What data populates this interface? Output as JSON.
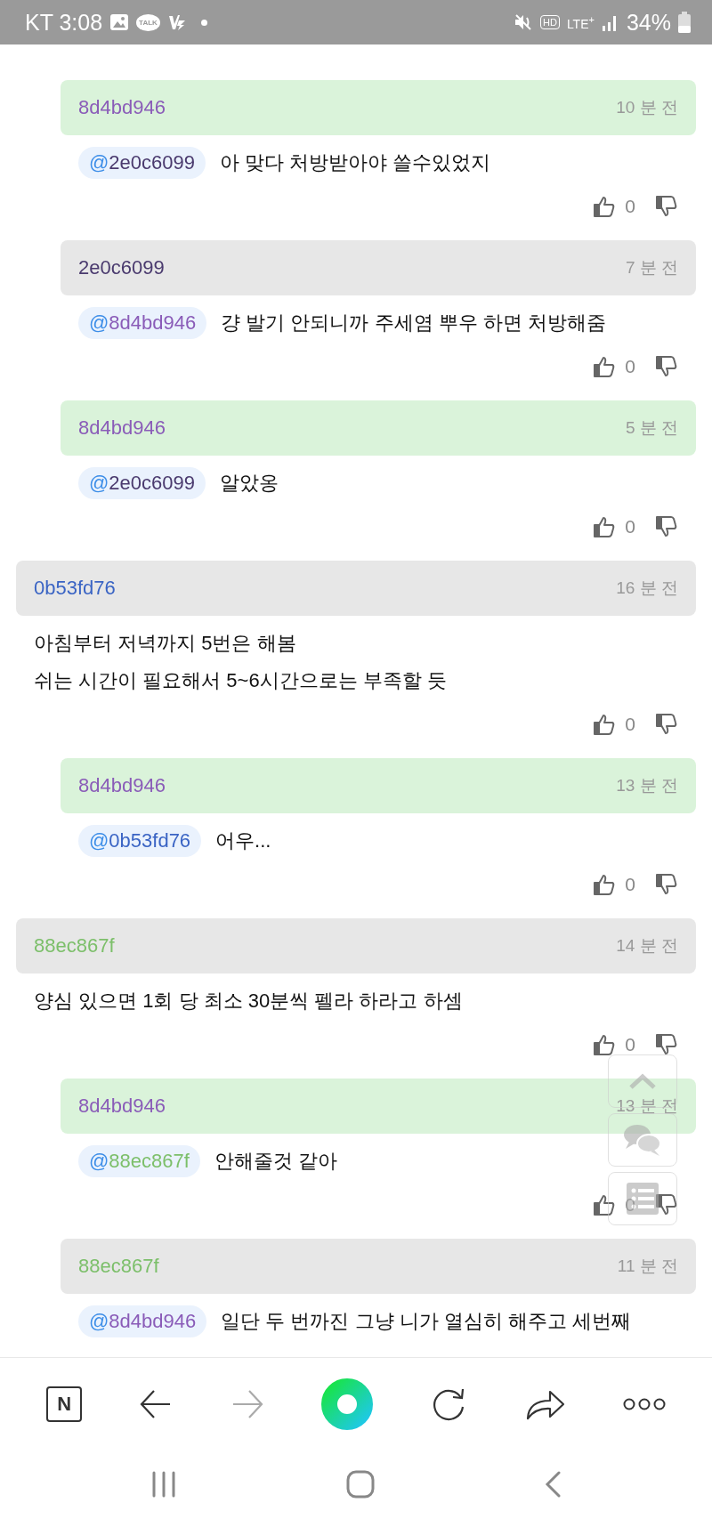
{
  "status_bar": {
    "carrier": "KT",
    "time": "3:08",
    "talk_badge": "TALK",
    "hd_badge": "HD",
    "network": "LTE",
    "network_plus": "+",
    "battery": "34%"
  },
  "comments": [
    {
      "kind": "reply",
      "author": "8d4bd946",
      "color": "#8a5cb8",
      "time": "10 분 전",
      "highlighted": true,
      "mention": {
        "author": "2e0c6099",
        "color": "#4a3a6e"
      },
      "lines": [
        "아 맞다 처방받아야 쓸수있었지"
      ],
      "likes": "0"
    },
    {
      "kind": "reply",
      "author": "2e0c6099",
      "color": "#4a3a6e",
      "time": "7 분 전",
      "highlighted": false,
      "mention": {
        "author": "8d4bd946",
        "color": "#8a5cb8"
      },
      "lines": [
        "걍 발기 안되니까 주세염 뿌우 하면 처방해줌"
      ],
      "likes": "0"
    },
    {
      "kind": "reply",
      "author": "8d4bd946",
      "color": "#8a5cb8",
      "time": "5 분 전",
      "highlighted": true,
      "mention": {
        "author": "2e0c6099",
        "color": "#4a3a6e"
      },
      "lines": [
        "알았옹"
      ],
      "likes": "0"
    },
    {
      "kind": "comment",
      "author": "0b53fd76",
      "color": "#3a64c4",
      "time": "16 분 전",
      "highlighted": false,
      "lines": [
        "아침부터 저녁까지 5번은 해봄",
        "쉬는 시간이 필요해서 5~6시간으로는 부족할 듯"
      ],
      "likes": "0"
    },
    {
      "kind": "reply",
      "author": "8d4bd946",
      "color": "#8a5cb8",
      "time": "13 분 전",
      "highlighted": true,
      "mention": {
        "author": "0b53fd76",
        "color": "#3a64c4"
      },
      "lines": [
        "어우..."
      ],
      "likes": "0"
    },
    {
      "kind": "comment",
      "author": "88ec867f",
      "color": "#7cbf6a",
      "time": "14 분 전",
      "highlighted": false,
      "lines": [
        "양심 있으면 1회 당 최소 30분씩 펠라 하라고 하셈"
      ],
      "likes": "0"
    },
    {
      "kind": "reply",
      "author": "8d4bd946",
      "color": "#8a5cb8",
      "time": "13 분 전",
      "highlighted": true,
      "mention": {
        "author": "88ec867f",
        "color": "#7cbf6a"
      },
      "lines": [
        "안해줄것 같아"
      ],
      "likes": "0"
    },
    {
      "kind": "reply",
      "author": "88ec867f",
      "color": "#7cbf6a",
      "time": "11 분 전",
      "highlighted": false,
      "mention": {
        "author": "8d4bd946",
        "color": "#8a5cb8"
      },
      "lines": [
        "일단 두 번까진 그냥 니가 열심히 해주고 세번째"
      ]
    }
  ],
  "mention_prefix": "@",
  "toolbar": {
    "logo": "N"
  }
}
